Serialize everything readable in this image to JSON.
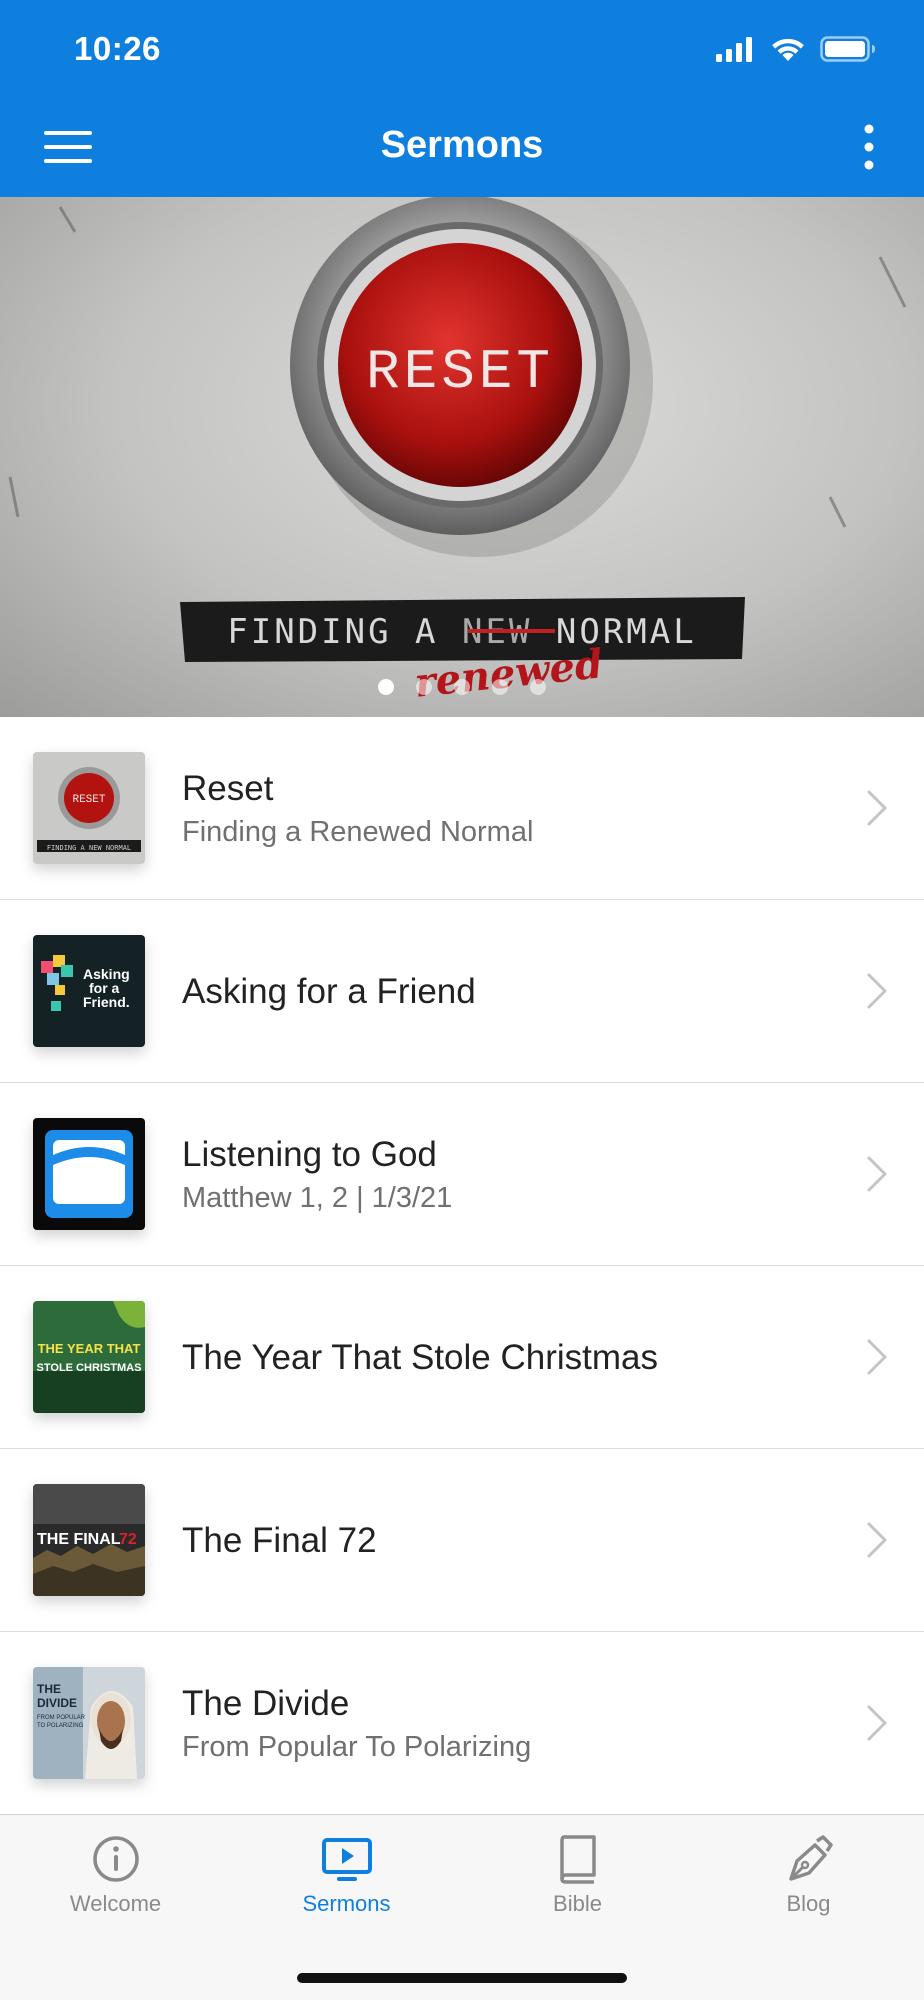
{
  "status_bar": {
    "time": "10:26"
  },
  "header": {
    "title": "Sermons"
  },
  "hero": {
    "button_text": "RESET",
    "tagline_prefix": "FINDING A",
    "tagline_struck": "NEW",
    "tagline_suffix": "NORMAL",
    "handwritten": "renewed",
    "page_count": 5,
    "active_page": 1
  },
  "sermons": [
    {
      "title": "Reset",
      "subtitle": "Finding a Renewed Normal",
      "thumb_text": "RESET"
    },
    {
      "title": "Asking for a Friend",
      "subtitle": "",
      "thumb_text": "Asking for a Friend."
    },
    {
      "title": "Listening to God",
      "subtitle": "Matthew 1, 2 | 1/3/21",
      "thumb_text": ""
    },
    {
      "title": "The Year That Stole Christmas",
      "subtitle": "",
      "thumb_text": "THE YEAR THAT STOLE CHRISTMAS"
    },
    {
      "title": "The Final 72",
      "subtitle": "",
      "thumb_text": "THE FINAL 72"
    },
    {
      "title": "The Divide",
      "subtitle": "From Popular To Polarizing",
      "thumb_text": "THE DIVIDE"
    }
  ],
  "tabs": [
    {
      "label": "Welcome",
      "icon": "info-icon",
      "active": false
    },
    {
      "label": "Sermons",
      "icon": "tv-play-icon",
      "active": true
    },
    {
      "label": "Bible",
      "icon": "book-icon",
      "active": false
    },
    {
      "label": "Blog",
      "icon": "pen-icon",
      "active": false
    }
  ],
  "colors": {
    "brand": "#0f7fdf",
    "inactive": "#8a8a8a"
  }
}
